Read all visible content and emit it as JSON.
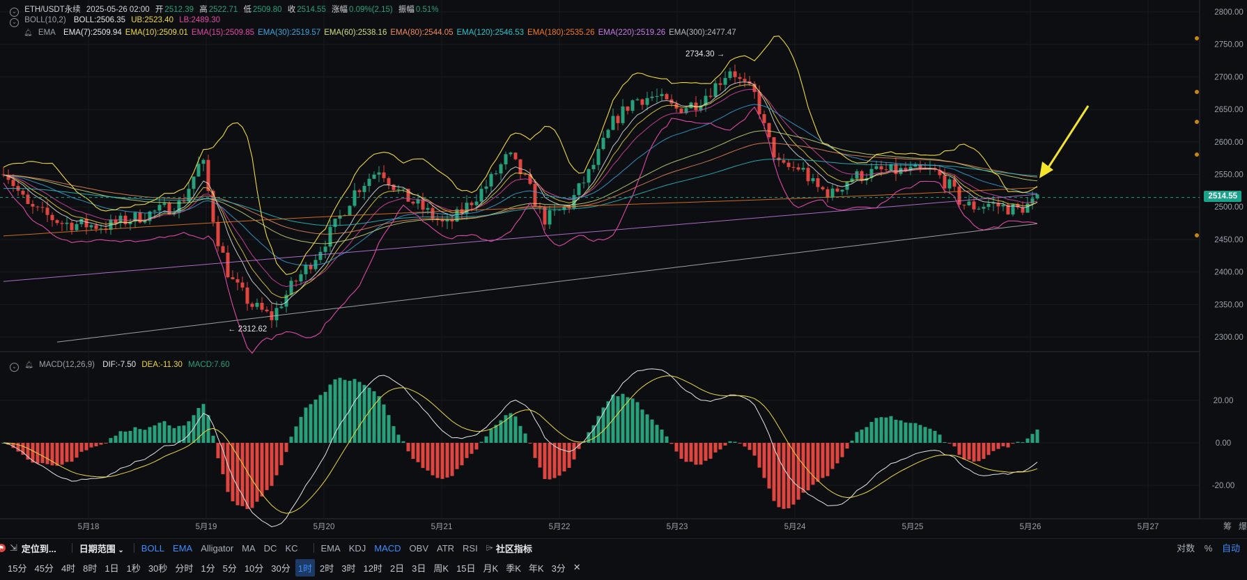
{
  "header": {
    "symbol": "ETH/USDT永续",
    "datetime": "2025-05-26 02:00",
    "open_label": "开",
    "open": "2512.39",
    "high_label": "高",
    "high": "2522.71",
    "low_label": "低",
    "low": "2509.80",
    "close_label": "收",
    "close": "2514.55",
    "change_label": "涨幅",
    "change": "0.09%(2.15)",
    "amp_label": "振幅",
    "amp": "0.51%"
  },
  "boll": {
    "name": "BOLL(10,2)",
    "mid": "BOLL:2506.35",
    "ub": "UB:2523.40",
    "lb": "LB:2489.30"
  },
  "ema": {
    "name": "EMA",
    "items": [
      {
        "text": "EMA(7):2509.94",
        "color": "#e6e6e6"
      },
      {
        "text": "EMA(10):2509.01",
        "color": "#f0d93c"
      },
      {
        "text": "EMA(15):2509.85",
        "color": "#e048a6"
      },
      {
        "text": "EMA(30):2519.57",
        "color": "#3aa6e0"
      },
      {
        "text": "EMA(60):2538.16",
        "color": "#c8e07a"
      },
      {
        "text": "EMA(80):2544.05",
        "color": "#f08a5d"
      },
      {
        "text": "EMA(120):2546.53",
        "color": "#27c2c7"
      },
      {
        "text": "EMA(180):2535.26",
        "color": "#f07a1f"
      },
      {
        "text": "EMA(220):2519.26",
        "color": "#c77ae8"
      },
      {
        "text": "EMA(300):2477.47",
        "color": "#b8b8b8"
      }
    ]
  },
  "macd": {
    "name": "MACD(12,26,9)",
    "dif": "DIF:-7.50",
    "dea": "DEA:-11.30",
    "macd": "MACD:7.60"
  },
  "annotations": {
    "high_mark": "2734.30 →",
    "low_mark": "← 2312.62"
  },
  "price_axis": [
    "2800.00",
    "2750.00",
    "2700.00",
    "2650.00",
    "2600.00",
    "2550.00",
    "2500.00",
    "2450.00",
    "2400.00",
    "2350.00",
    "2300.00"
  ],
  "current_price": "2514.55",
  "macd_axis": [
    "20.00",
    "0.00",
    "-20.00"
  ],
  "time_axis": [
    "5月18",
    "5月19",
    "5月20",
    "5月21",
    "5月22",
    "5月23",
    "5月24",
    "5月25",
    "5月26",
    "5月27"
  ],
  "corner_labels": [
    "筹",
    "爆"
  ],
  "toolbar": {
    "locate": "定位到...",
    "date_range": "日期范围",
    "main_indicators": [
      "BOLL",
      "EMA",
      "Alligator",
      "MA",
      "DC",
      "KC"
    ],
    "main_active": [
      "BOLL",
      "EMA"
    ],
    "sub_indicators": [
      "EMA",
      "KDJ",
      "MACD",
      "OBV",
      "ATR",
      "RSI"
    ],
    "sub_active": [
      "MACD"
    ],
    "community": "社区指标",
    "right": {
      "log": "对数",
      "percent": "%",
      "auto": "自动"
    }
  },
  "intervals": [
    "15分",
    "45分",
    "4时",
    "8时",
    "1日",
    "1秒",
    "30秒",
    "分时",
    "1分",
    "5分",
    "10分",
    "30分",
    "1时",
    "2时",
    "3时",
    "12时",
    "2日",
    "3日",
    "周K",
    "15日",
    "月K",
    "季K",
    "年K",
    "3分"
  ],
  "active_interval": "1时",
  "colors": {
    "up": "#26a17b",
    "down": "#e0463f",
    "accent": "#3b8cff",
    "arrow": "#f5e52a"
  }
}
